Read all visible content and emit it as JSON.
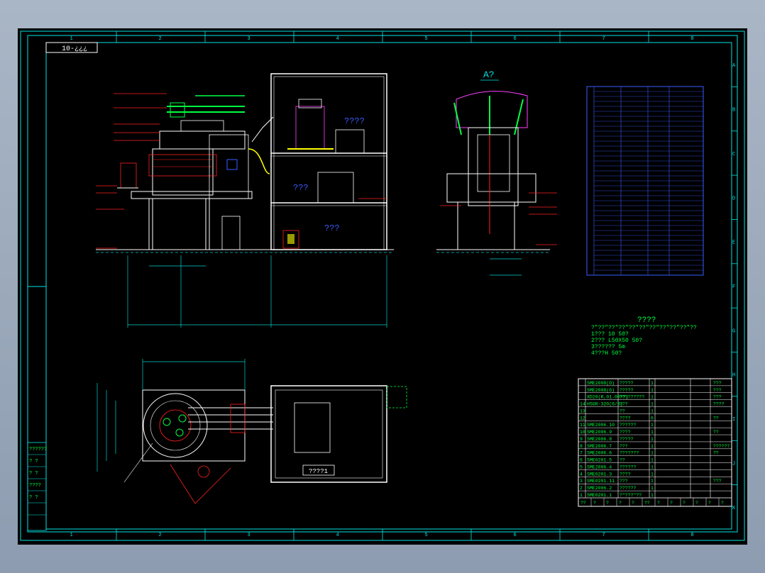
{
  "sheet": {
    "title_box": "10-¿¿¿",
    "col_marks": [
      "1",
      "2",
      "3",
      "4",
      "5",
      "6",
      "7",
      "8"
    ],
    "row_marks": [
      "A",
      "B",
      "C",
      "D",
      "E",
      "F",
      "G",
      "H",
      "I",
      "J",
      "K"
    ]
  },
  "views": {
    "view_a_label": "A?",
    "room_top": "????",
    "room_mid": "???",
    "room_bottom": "???",
    "plan_box_label": "????1"
  },
  "notes": {
    "heading": "????",
    "lines": [
      "?\"??\"??\"??\"??\"??\"??\"??\"??\"??\"??",
      "1???   10   50?",
      "2??? L50X50   50?",
      "3?????? 5m",
      "4???H    50?"
    ]
  },
  "left_title_block": {
    "rows": [
      "??????",
      "?   ?",
      "?   ?",
      "????",
      "?   ?",
      "",
      ""
    ]
  },
  "parts_list": {
    "rows": [
      {
        "no": "",
        "code": "SME2008(D)",
        "name": "?????",
        "qty": "1",
        "remark": "???"
      },
      {
        "no": "",
        "code": "SME2008(G)",
        "name": "?????",
        "qty": "1",
        "remark": "???"
      },
      {
        "no": "",
        "code": "XD20(R,01.00??)",
        "name": "?????????",
        "qty": "1",
        "remark": "???"
      },
      {
        "no": "14",
        "code": "HSGR-320(6/3)",
        "name": "???",
        "qty": "1",
        "remark": "????"
      },
      {
        "no": "13",
        "code": "",
        "name": "??",
        "qty": "1",
        "remark": ""
      },
      {
        "no": "12",
        "code": "",
        "name": "????",
        "qty": "6",
        "remark": "??"
      },
      {
        "no": "11",
        "code": "SME2006.10",
        "name": "??????",
        "qty": "1",
        "remark": ""
      },
      {
        "no": "10",
        "code": "SME2006.9",
        "name": "????",
        "qty": "1",
        "remark": "??"
      },
      {
        "no": "9",
        "code": "SME2006.8",
        "name": "?????",
        "qty": "1",
        "remark": ""
      },
      {
        "no": "8",
        "code": "SME2006.7",
        "name": "???",
        "qty": "1",
        "remark": "??????"
      },
      {
        "no": "7",
        "code": "SME2006.6",
        "name": "???????",
        "qty": "1",
        "remark": "??"
      },
      {
        "no": "6",
        "code": "SME0201.5",
        "name": "??",
        "qty": "1",
        "remark": ""
      },
      {
        "no": "5",
        "code": "SME2006.4",
        "name": "??????",
        "qty": "1",
        "remark": ""
      },
      {
        "no": "4",
        "code": "SME0201.3",
        "name": "????",
        "qty": "1",
        "remark": ""
      },
      {
        "no": "3",
        "code": "SME0201.11",
        "name": "???",
        "qty": "1",
        "remark": "???"
      },
      {
        "no": "2",
        "code": "SME2006.2",
        "name": "??????",
        "qty": "1",
        "remark": ""
      },
      {
        "no": "1",
        "code": "SME0201.1",
        "name": "?\"???\"??",
        "qty": "1",
        "remark": ""
      }
    ],
    "footer": [
      "??",
      "?",
      "?",
      "?",
      "?",
      "??",
      "?",
      "?",
      "?",
      "?",
      "?",
      "?"
    ]
  },
  "colors": {
    "frame": "#00e5e5",
    "outline": "#ffffff",
    "dim": "#00d0d0",
    "note": "#00ff40",
    "red": "#ff2020",
    "magenta": "#ff40ff",
    "blue": "#3a5cff",
    "yellow": "#ffff00"
  }
}
